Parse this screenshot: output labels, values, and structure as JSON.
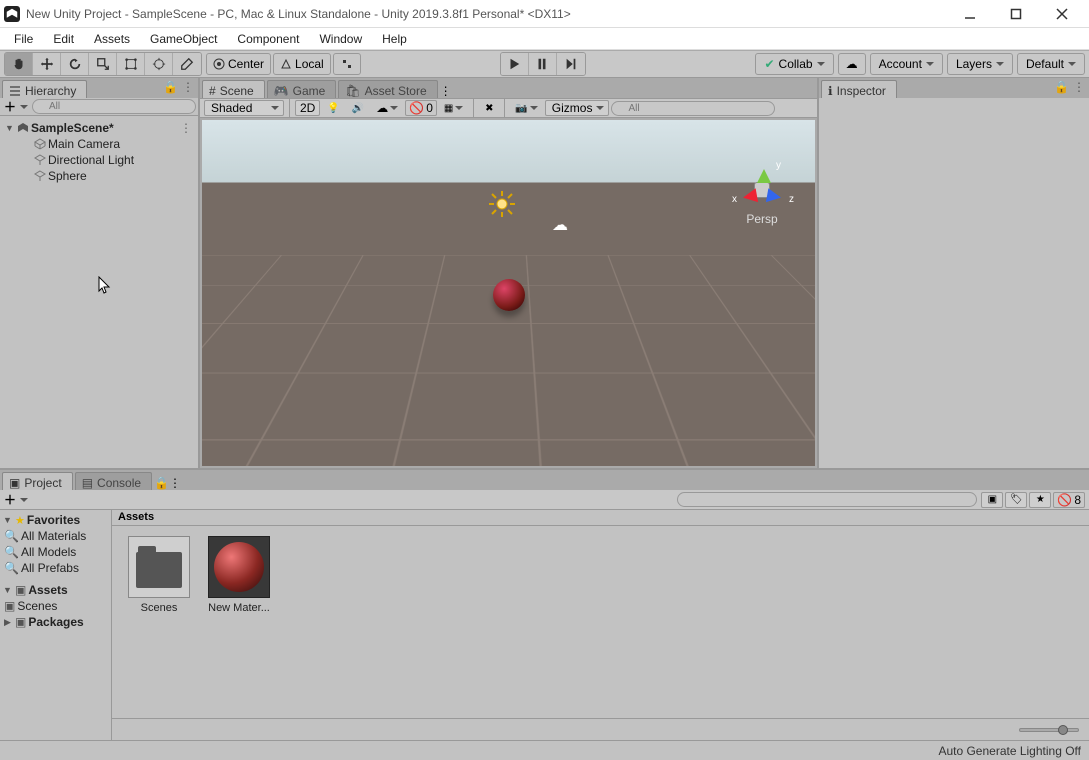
{
  "window": {
    "title": "New Unity Project - SampleScene - PC, Mac & Linux Standalone - Unity 2019.3.8f1 Personal* <DX11>"
  },
  "menu": {
    "items": [
      "File",
      "Edit",
      "Assets",
      "GameObject",
      "Component",
      "Window",
      "Help"
    ]
  },
  "toolbar": {
    "pivot_center": "Center",
    "pivot_local": "Local",
    "collab": "Collab",
    "account": "Account",
    "layers": "Layers",
    "layout": "Default"
  },
  "hierarchy": {
    "tab": "Hierarchy",
    "search_placeholder": "All",
    "scene": "SampleScene*",
    "items": [
      "Main Camera",
      "Directional Light",
      "Sphere"
    ]
  },
  "scene": {
    "tabs": [
      "Scene",
      "Game",
      "Asset Store"
    ],
    "shading": "Shaded",
    "twod": "2D",
    "gizmos": "Gizmos",
    "search_placeholder": "All",
    "persp": "Persp",
    "axes": {
      "x": "x",
      "y": "y",
      "z": "z"
    },
    "hidden_count": "0"
  },
  "inspector": {
    "tab": "Inspector"
  },
  "project": {
    "tabs": [
      "Project",
      "Console"
    ],
    "favorites": "Favorites",
    "fav_items": [
      "All Materials",
      "All Models",
      "All Prefabs"
    ],
    "assets": "Assets",
    "assets_children": [
      "Scenes"
    ],
    "packages": "Packages",
    "crumb": "Assets",
    "items": [
      {
        "name": "Scenes",
        "kind": "folder"
      },
      {
        "name": "New Mater...",
        "kind": "material"
      }
    ],
    "hidden_count": "8"
  },
  "footer": {
    "lighting": "Auto Generate Lighting Off"
  }
}
